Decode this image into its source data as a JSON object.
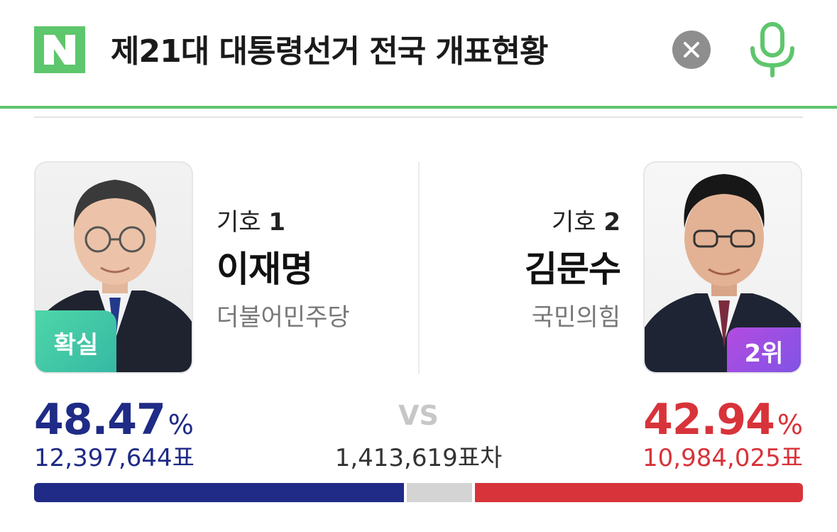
{
  "search": {
    "query": "제21대 대통령선거 전국 개표현황",
    "logo_letter": "N",
    "clear_icon": "close-icon",
    "voice_icon": "microphone-icon"
  },
  "colors": {
    "naver_green": "#5ec66c",
    "left_blue": "#1f2b86",
    "right_red": "#d8333a",
    "confirmed_green": "#3fc7a6",
    "rank_purple": "#9a4fe4"
  },
  "candidates": [
    {
      "number_label": "기호",
      "number": "1",
      "name": "이재명",
      "party": "더불어민주당",
      "badge": "확실",
      "percent": "48.47",
      "percent_unit": "%",
      "votes": "12,397,644표",
      "vote_share": 48.47
    },
    {
      "number_label": "기호",
      "number": "2",
      "name": "김문수",
      "party": "국민의힘",
      "badge": "2위",
      "percent": "42.94",
      "percent_unit": "%",
      "votes": "10,984,025표",
      "vote_share": 42.94
    }
  ],
  "comparison": {
    "vs_label": "VS",
    "difference": "1,413,619표차"
  }
}
